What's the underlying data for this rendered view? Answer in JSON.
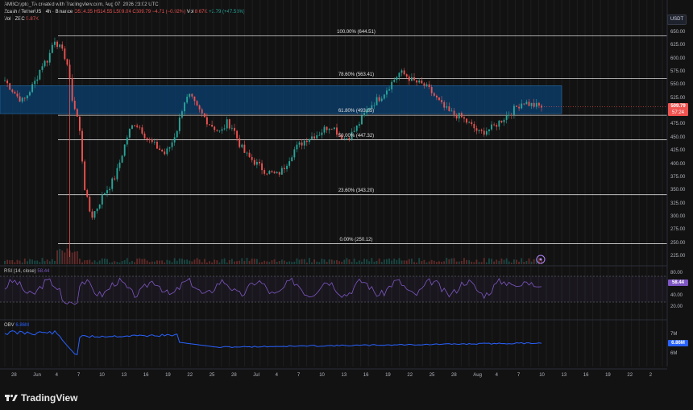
{
  "header": {
    "publisher": "AMBCrypto_TA created with TradingView.com, Aug 07, 2026 23:02 UTC",
    "symbol": "Zcash / TetherUS · 4h · Binance",
    "open": "O514.35",
    "high": "H514.55",
    "low": "L509.04",
    "close": "C509.79",
    "change": "−4.71 (−0.92%)",
    "vol_label": "Vol · ZEC",
    "vol_value": "5.87K",
    "vol_ma": "Vol",
    "vol_ma_value": "8.67K",
    "vol_ma_change": "+2.79 (+47.56%)"
  },
  "currency": "USDT",
  "price_axis": [
    "650.00",
    "625.00",
    "600.00",
    "575.00",
    "550.00",
    "525.00",
    "500.00",
    "475.00",
    "450.00",
    "425.00",
    "400.00",
    "375.00",
    "350.00",
    "325.00",
    "300.00",
    "275.00",
    "250.00",
    "225.00"
  ],
  "current_price": {
    "value": "509.79",
    "countdown": "57:24"
  },
  "fib_levels": [
    {
      "label": "100.00% (644.51)",
      "price": 644.51
    },
    {
      "label": "78.60% (563.41)",
      "price": 563.41
    },
    {
      "label": "61.80% (493.85)",
      "price": 493.85
    },
    {
      "label": "50.00% (447.32)",
      "price": 447.32
    },
    {
      "label": "23.60% (343.20)",
      "price": 343.2
    },
    {
      "label": "0.00% (250.12)",
      "price": 250.12
    }
  ],
  "zone": {
    "top": 550,
    "bottom": 497
  },
  "rsi": {
    "label": "RSI (14, close)",
    "value": "58.44",
    "axis": [
      "80.00",
      "60.00",
      "40.00",
      "20.00"
    ],
    "levels": [
      70,
      30
    ]
  },
  "obv": {
    "label": "OBV",
    "value": "6.86M",
    "axis": [
      "7M",
      "6M"
    ]
  },
  "time_axis": [
    "28",
    "Jun",
    "4",
    "7",
    "10",
    "13",
    "16",
    "19",
    "22",
    "25",
    "28",
    "Jul",
    "4",
    "7",
    "10",
    "13",
    "16",
    "19",
    "22",
    "25",
    "28",
    "Aug",
    "4",
    "7",
    "10",
    "13",
    "16",
    "19",
    "22",
    "2"
  ],
  "colors": {
    "up": "#26a69a",
    "down": "#ef5350",
    "zone": "#0c3b66",
    "rsi": "#7e57c2",
    "obv": "#2962ff",
    "price_tag": "#ef5350"
  },
  "brand": "TradingView",
  "chart_data": {
    "type": "candlestick",
    "interval": "4h",
    "ylim": [
      225,
      660
    ],
    "close_path": [
      560,
      545,
      530,
      520,
      540,
      560,
      590,
      600,
      640,
      620,
      600,
      520,
      480,
      350,
      300,
      320,
      345,
      360,
      380,
      420,
      460,
      480,
      470,
      450,
      440,
      430,
      420,
      440,
      470,
      520,
      530,
      510,
      495,
      480,
      470,
      460,
      480,
      470,
      440,
      420,
      410,
      400,
      390,
      385,
      380,
      390,
      410,
      430,
      440,
      450,
      455,
      460,
      470,
      475,
      460,
      450,
      455,
      470,
      490,
      510,
      520,
      530,
      545,
      560,
      575,
      570,
      560,
      555,
      550,
      540,
      525,
      510,
      500,
      495,
      490,
      480,
      470,
      460,
      465,
      470,
      480,
      490,
      500,
      510,
      520,
      515,
      512,
      510
    ]
  }
}
